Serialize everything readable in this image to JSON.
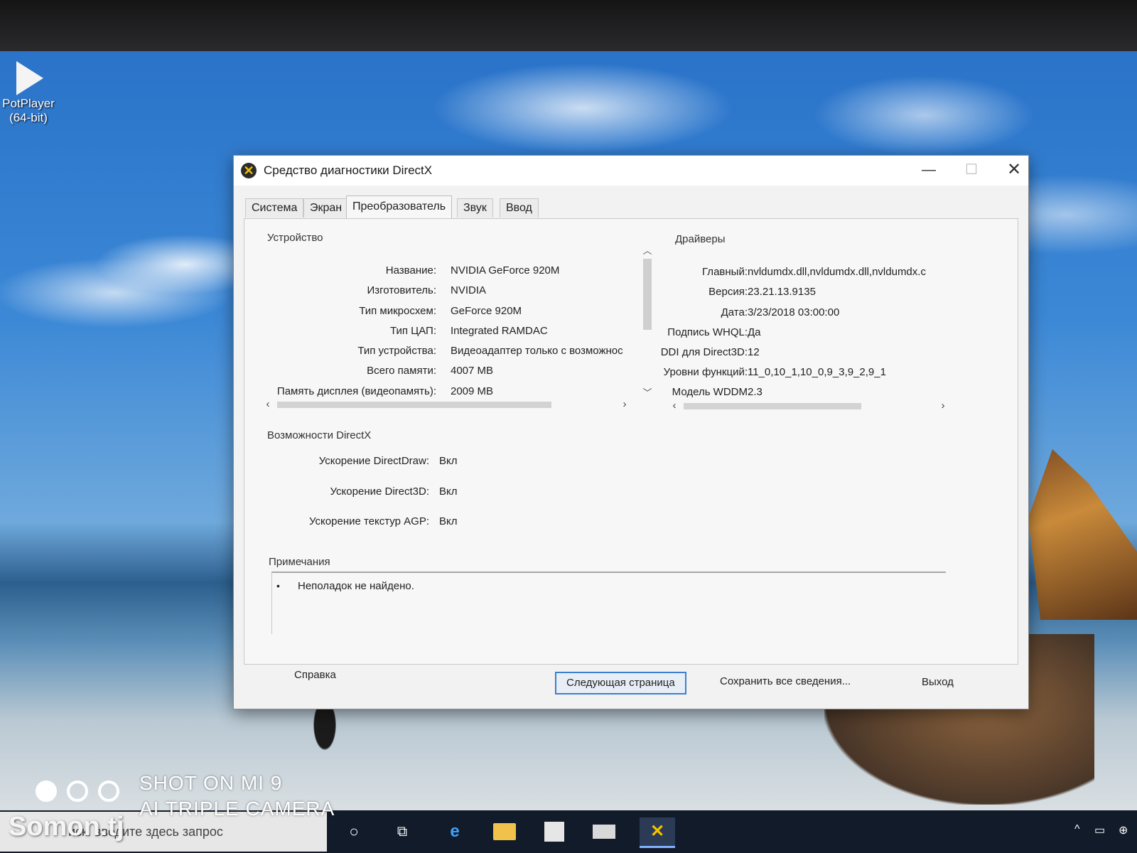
{
  "desktop": {
    "icons": [
      {
        "label_line1": "PotPlayer",
        "label_line2": "(64-bit)",
        "icon": "play-icon"
      }
    ]
  },
  "window": {
    "title": "Средство диагностики DirectX",
    "controls": {
      "minimize": "—",
      "maximize": "☐",
      "close": "✕"
    },
    "tabs": [
      {
        "label": "Система"
      },
      {
        "label": "Экран"
      },
      {
        "label": "Преобразователь",
        "active": true
      },
      {
        "label": "Звук"
      },
      {
        "label": "Ввод"
      }
    ],
    "device": {
      "title": "Устройство",
      "rows": [
        {
          "key": "Название:",
          "value": "NVIDIA GeForce 920M"
        },
        {
          "key": "Изготовитель:",
          "value": "NVIDIA"
        },
        {
          "key": "Тип микросхем:",
          "value": "GeForce 920M"
        },
        {
          "key": "Тип ЦАП:",
          "value": "Integrated RAMDAC"
        },
        {
          "key": "Тип устройства:",
          "value": "Видеоадаптер только с возможнос"
        },
        {
          "key": "Всего памяти:",
          "value": "4007 MB"
        },
        {
          "key": "Память дисплея (видеопамять):",
          "value": "2009 MB"
        }
      ]
    },
    "drivers": {
      "title": "Драйверы",
      "rows": [
        {
          "key": "Главный:",
          "value": "nvldumdx.dll,nvldumdx.dll,nvldumdx.c"
        },
        {
          "key": "Версия:",
          "value": "23.21.13.9135"
        },
        {
          "key": "Дата:",
          "value": "3/23/2018 03:00:00"
        },
        {
          "key": "Подпись WHQL:",
          "value": "Да"
        },
        {
          "key": "DDI для Direct3D:",
          "value": "12"
        },
        {
          "key": "Уровни функций:",
          "value": "11_0,10_1,10_0,9_3,9_2,9_1"
        },
        {
          "key": "Модель WDDM",
          "value": "2.3"
        }
      ]
    },
    "features": {
      "title": "Возможности DirectX",
      "rows": [
        {
          "key": "Ускорение DirectDraw:",
          "value": "Вкл"
        },
        {
          "key": "Ускорение Direct3D:",
          "value": "Вкл"
        },
        {
          "key": "Ускорение текстур AGP:",
          "value": "Вкл"
        }
      ]
    },
    "notes": {
      "title": "Примечания",
      "items": [
        "Неполадок не найдено."
      ]
    },
    "buttons": {
      "help": "Справка",
      "next": "Следующая страница",
      "save": "Сохранить все сведения...",
      "exit": "Выход"
    }
  },
  "taskbar": {
    "search_placeholder": "иск. введите здесь запрос"
  },
  "watermark": {
    "line1": "SHOT ON MI 9",
    "line2": "AI TRIPLE CAMERA",
    "brand": "Somon.tj"
  }
}
